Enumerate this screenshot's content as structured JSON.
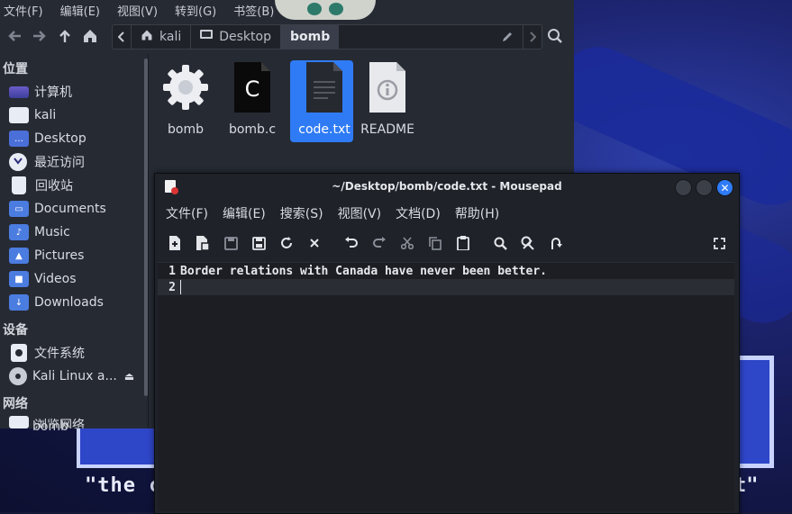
{
  "desktop": {
    "quote_start": "\"the c",
    "quote_end": "t\""
  },
  "file_manager": {
    "menu": [
      "文件(F)",
      "编辑(E)",
      "视图(V)",
      "转到(G)",
      "书签(B)"
    ],
    "breadcrumbs": [
      {
        "label": "kali",
        "icon": "home-icon"
      },
      {
        "label": "Desktop",
        "icon": "desktop-icon"
      },
      {
        "label": "bomb",
        "icon": ""
      }
    ],
    "sidebar": {
      "places_header": "位置",
      "places": [
        {
          "label": "计算机",
          "icon": "computer-icon"
        },
        {
          "label": "kali",
          "icon": "home-folder-icon"
        },
        {
          "label": "Desktop",
          "icon": "desktop-folder-icon"
        },
        {
          "label": "最近访问",
          "icon": "recent-icon"
        },
        {
          "label": "回收站",
          "icon": "trash-icon"
        },
        {
          "label": "Documents",
          "icon": "documents-folder-icon"
        },
        {
          "label": "Music",
          "icon": "music-folder-icon"
        },
        {
          "label": "Pictures",
          "icon": "pictures-folder-icon"
        },
        {
          "label": "Videos",
          "icon": "videos-folder-icon"
        },
        {
          "label": "Downloads",
          "icon": "downloads-folder-icon"
        }
      ],
      "devices_header": "设备",
      "devices": [
        {
          "label": "文件系统",
          "icon": "filesystem-icon"
        },
        {
          "label": "Kali Linux a...",
          "icon": "disc-icon"
        }
      ],
      "network_header": "网络",
      "network": [
        {
          "label": "浏览网络",
          "icon": "network-icon"
        }
      ]
    },
    "files": [
      {
        "name": "bomb",
        "icon": "executable-gear-icon",
        "selected": false
      },
      {
        "name": "bomb.c",
        "icon": "c-source-icon",
        "selected": false
      },
      {
        "name": "code.txt",
        "icon": "text-file-icon",
        "selected": true
      },
      {
        "name": "README",
        "icon": "info-file-icon",
        "selected": false
      }
    ],
    "partially_hidden_label": "bomb"
  },
  "mousepad": {
    "title": "~/Desktop/bomb/code.txt - Mousepad",
    "menu": [
      "文件(F)",
      "编辑(E)",
      "搜索(S)",
      "视图(V)",
      "文档(D)",
      "帮助(H)"
    ],
    "lines": [
      {
        "number": "1",
        "text": "Border relations with Canada have never been better."
      },
      {
        "number": "2",
        "text": ""
      }
    ]
  }
}
